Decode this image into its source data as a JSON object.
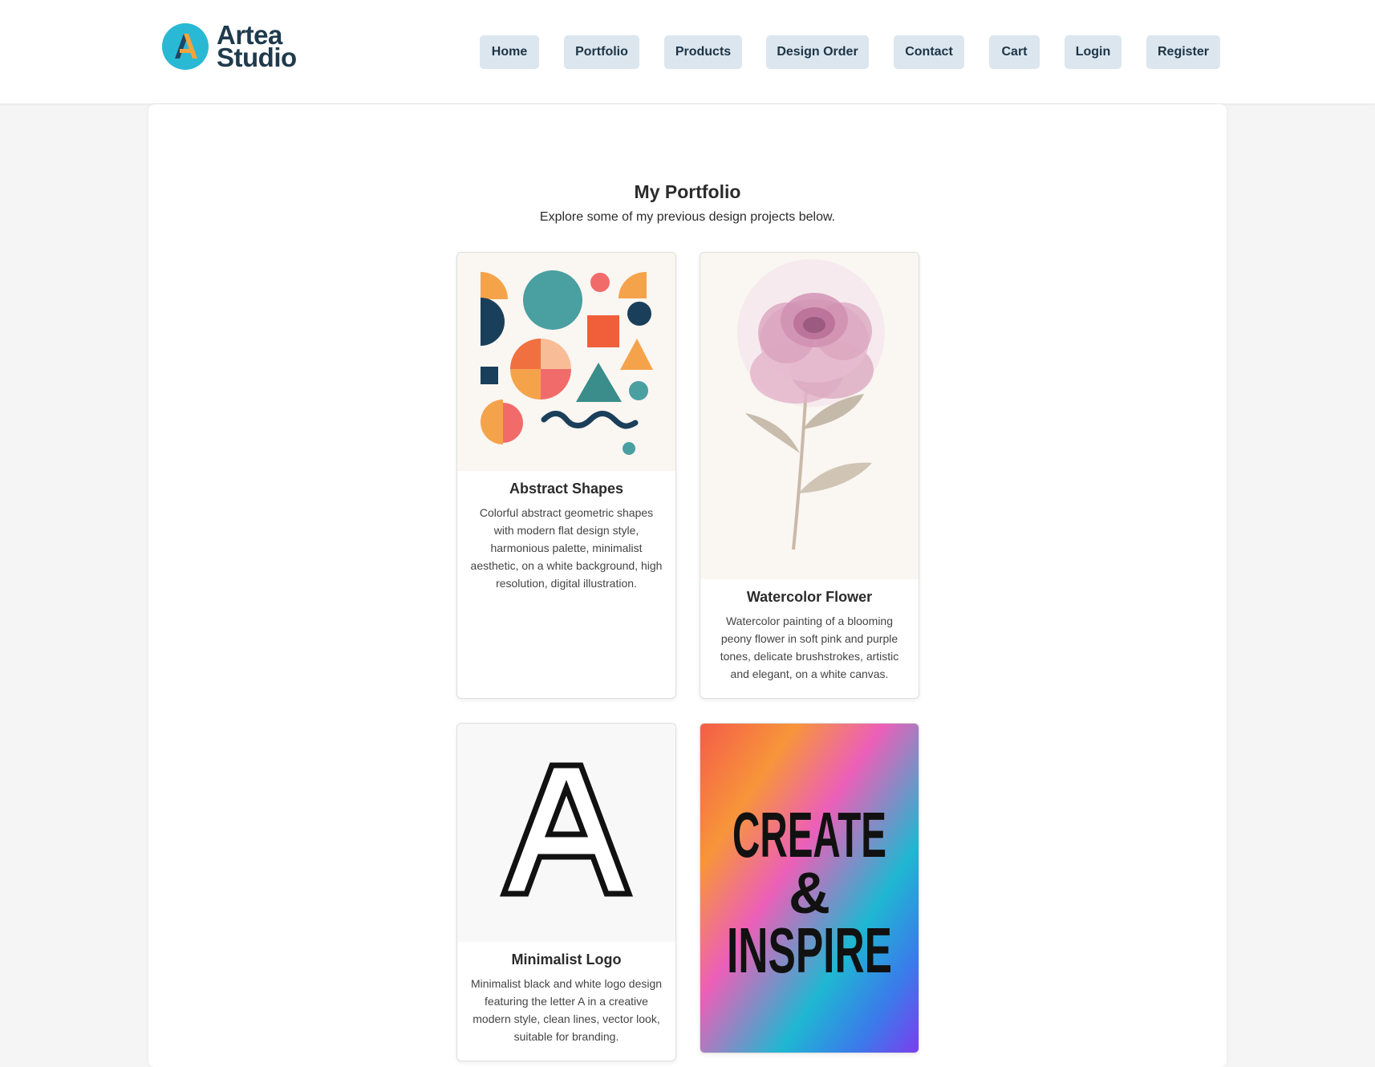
{
  "brand": {
    "line1": "Artea",
    "line2": "Studio",
    "icon": "logo-a-icon",
    "colors": {
      "circle": "#29b9d4",
      "letter_dark": "#1e4566",
      "letter_accent": "#f5a33c",
      "text": "#1f3a4d"
    }
  },
  "nav": {
    "items": [
      {
        "label": "Home"
      },
      {
        "label": "Portfolio"
      },
      {
        "label": "Products"
      },
      {
        "label": "Design Order"
      },
      {
        "label": "Contact"
      },
      {
        "label": "Cart"
      },
      {
        "label": "Login"
      },
      {
        "label": "Register"
      }
    ],
    "button_color": "#dce6ee"
  },
  "page": {
    "title": "My Portfolio",
    "subtitle": "Explore some of my previous design projects below."
  },
  "portfolio": {
    "items": [
      {
        "title": "Abstract Shapes",
        "description": "Colorful abstract geometric shapes with modern flat design style, harmonious palette, minimalist aesthetic, on a white background, high resolution, digital illustration.",
        "image": "abstract-shapes-illustration"
      },
      {
        "title": "Watercolor Flower",
        "description": "Watercolor painting of a blooming peony flower in soft pink and purple tones, delicate brushstrokes, artistic and elegant, on a white canvas.",
        "image": "watercolor-peony-illustration"
      },
      {
        "title": "Minimalist Logo",
        "description": "Minimalist black and white logo design featuring the letter A in a creative modern style, clean lines, vector look, suitable for branding.",
        "image": "letter-a-logo-illustration"
      },
      {
        "title": "",
        "description": "",
        "image": "typography-poster-illustration",
        "poster_lines": [
          "CREATE",
          "&",
          "INSPIRE"
        ]
      }
    ]
  },
  "colors": {
    "page_bg": "#f5f5f5",
    "panel_bg": "#ffffff",
    "palette": [
      "#1a3f5a",
      "#4a9fa1",
      "#f08a5d",
      "#f5a34b",
      "#f16b6b",
      "#f8c29e"
    ]
  }
}
